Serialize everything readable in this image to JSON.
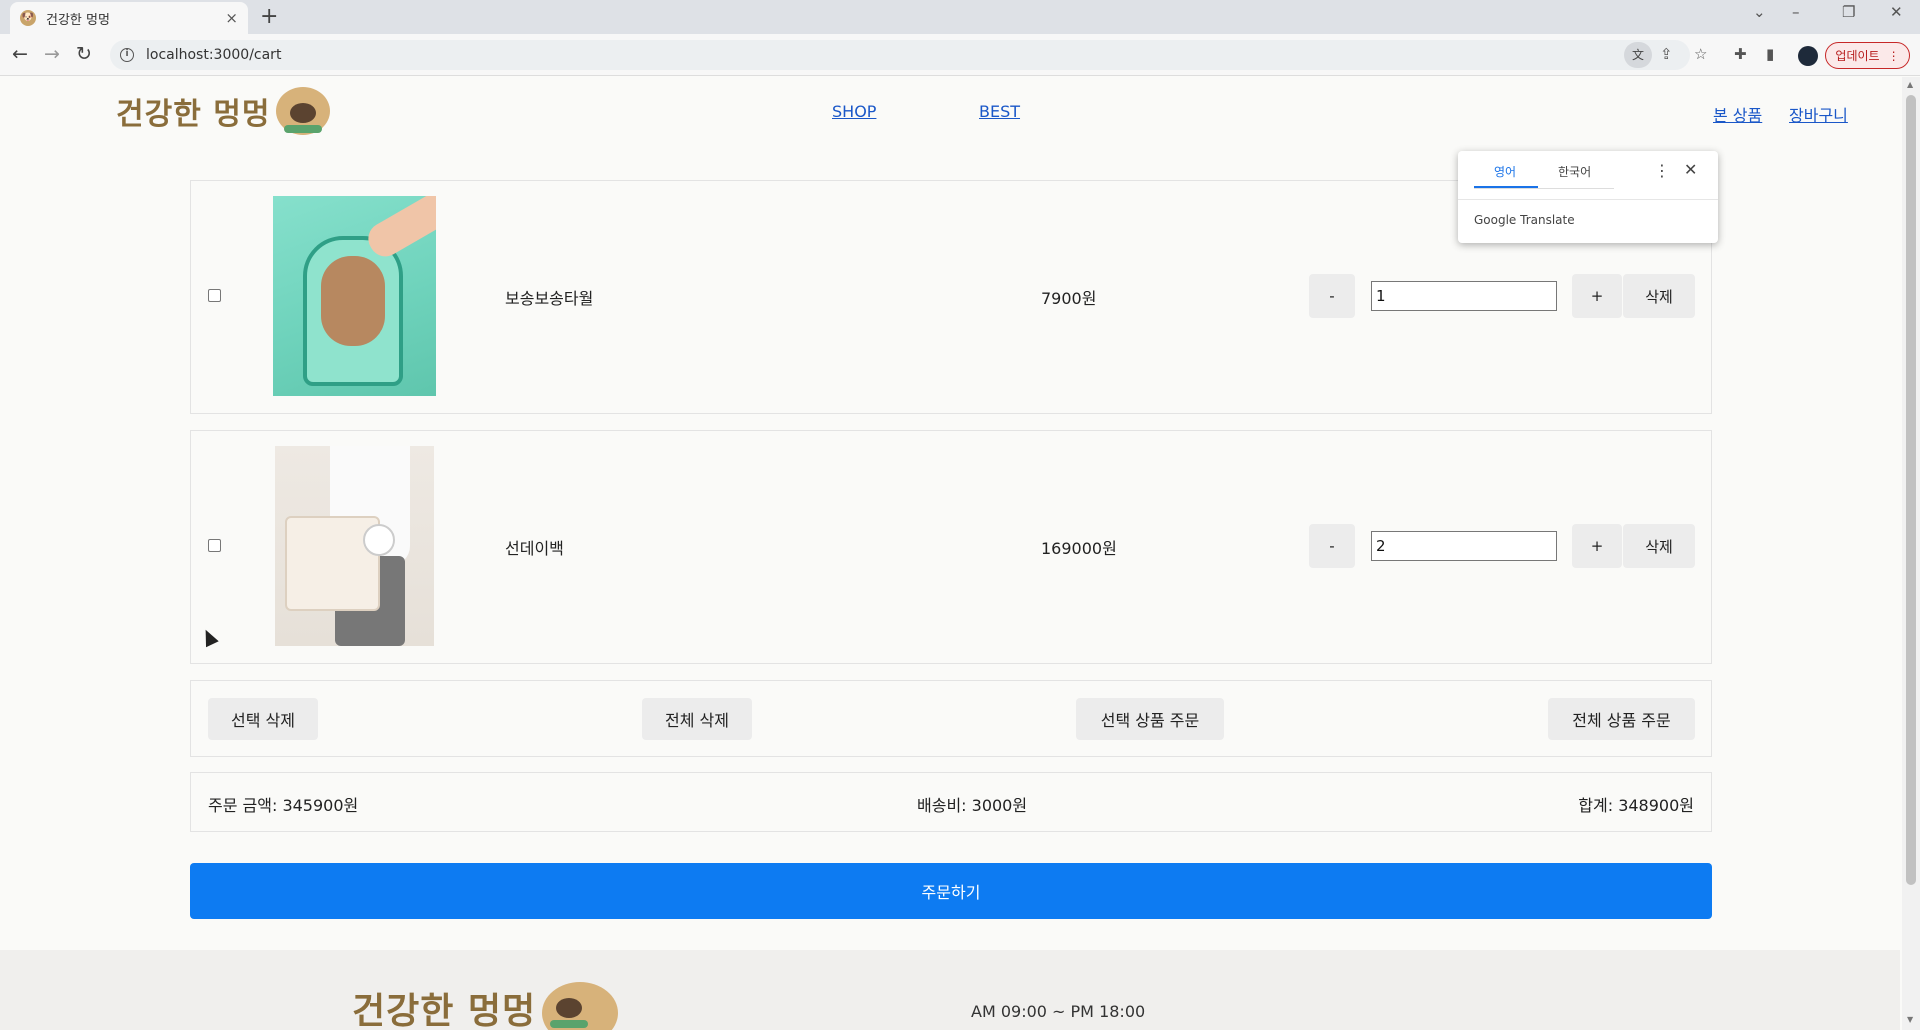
{
  "browser": {
    "tab_title": "건강한 멍멍",
    "tab_close": "×",
    "new_tab": "+",
    "url": "localhost:3000/cart",
    "update_label": "업데이트",
    "window_controls": [
      "⌄",
      "–",
      "❐",
      "✕"
    ]
  },
  "header": {
    "logo_text": "건강한 멍멍",
    "nav": [
      {
        "label": "SHOP"
      },
      {
        "label": "BEST"
      },
      {
        "label": "본 상품"
      },
      {
        "label": "장바구니"
      }
    ]
  },
  "translate_popup": {
    "tabs": [
      "영어",
      "한국어"
    ],
    "menu_icon": "⋮",
    "close_icon": "✕",
    "brand": "Google Translate"
  },
  "cart": {
    "items": [
      {
        "name": "보송보송타월",
        "price": "7900원",
        "quantity": "1",
        "checked": false,
        "image": "towel-dog-photo"
      },
      {
        "name": "선데이백",
        "price": "169000원",
        "quantity": "2",
        "checked": false,
        "image": "carrier-bag-dog-photo"
      }
    ],
    "minus_label": "-",
    "plus_label": "+",
    "delete_label": "삭제"
  },
  "actions": {
    "delete_selected": "선택 삭제",
    "delete_all": "전체 삭제",
    "order_selected": "선택 상품 주문",
    "order_all": "전체 상품 주문"
  },
  "summary": {
    "order_amount": "주문 금액: 345900원",
    "shipping": "배송비: 3000원",
    "total": "합계: 348900원"
  },
  "order_button": "주문하기",
  "footer": {
    "logo_text": "건강한 멍멍",
    "hours": "AM 09:00 ~ PM 18:00"
  },
  "colors": {
    "accent": "#0d7bf2",
    "link": "#1a57c8",
    "logo": "#8a6d3b"
  }
}
